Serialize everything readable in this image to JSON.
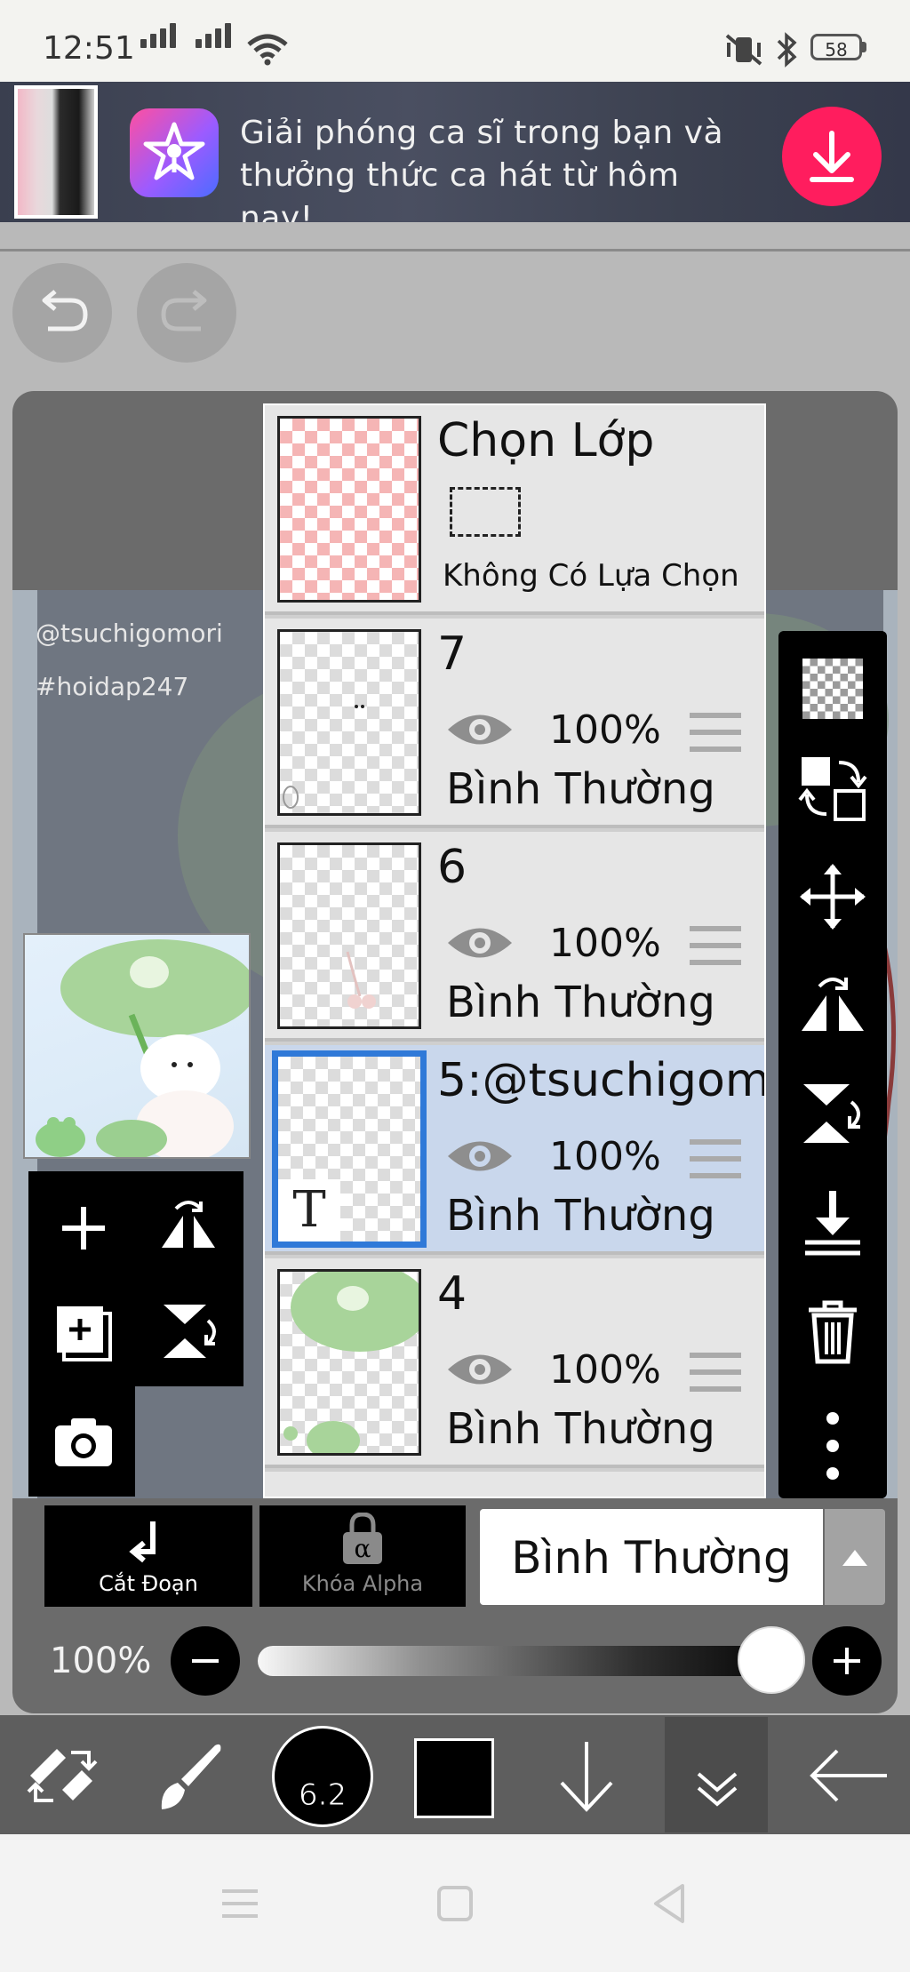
{
  "status_bar": {
    "time": "12:51",
    "battery": "58"
  },
  "ad": {
    "text": "Giải phóng ca sĩ trong bạn và thưởng thức ca hát từ hôm nay!"
  },
  "canvas": {
    "watermark_line1": "@tsuchigomori",
    "watermark_line2": "#hoidap247"
  },
  "layers": {
    "selection": {
      "title": "Chọn Lớp",
      "subtitle": "Không Có Lựa Chọn"
    },
    "items": [
      {
        "name": "7",
        "opacity": "100%",
        "blend": "Bình Thường"
      },
      {
        "name": "6",
        "opacity": "100%",
        "blend": "Bình Thường"
      },
      {
        "name": "5:@tsuchigom",
        "opacity": "100%",
        "blend": "Bình Thường"
      },
      {
        "name": "4",
        "opacity": "100%",
        "blend": "Bình Thường"
      }
    ]
  },
  "controls": {
    "cut_label": "Cắt Đoạn",
    "alpha_lock_label": "Khóa Alpha",
    "blend_mode": "Bình Thường",
    "opacity": "100%"
  },
  "toolbar": {
    "brush_size": "6.2",
    "color": "#000000"
  }
}
